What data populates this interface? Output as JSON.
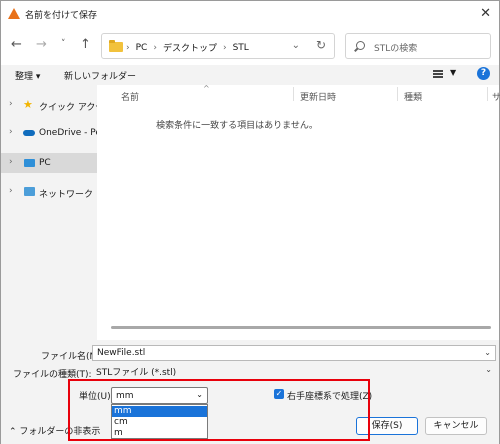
{
  "window": {
    "title": "名前を付けて保存"
  },
  "nav": {
    "back": "←",
    "forward": "→",
    "recent": "˅",
    "up": "↑",
    "breadcrumbs": [
      "PC",
      "デスクトップ",
      "STL"
    ],
    "sep": "›",
    "refresh": "↻",
    "search_placeholder": "STLの検索"
  },
  "toolbar": {
    "organize": "整理 ▾",
    "new_folder": "新しいフォルダー",
    "help": "?"
  },
  "sidebar": {
    "items": [
      {
        "label": "クイック アクセス"
      },
      {
        "label": "OneDrive - Per"
      },
      {
        "label": "PC"
      },
      {
        "label": "ネットワーク"
      }
    ]
  },
  "filelist": {
    "columns": [
      "名前",
      "更新日時",
      "種類",
      "サ"
    ],
    "empty_message": "検索条件に一致する項目はありません。"
  },
  "form": {
    "filename_label": "ファイル名(N):",
    "filename_value": "NewFile.stl",
    "filetype_label": "ファイルの種類(T):",
    "filetype_value": "STLファイル (*.stl)",
    "unit_label": "単位(U):",
    "unit_value": "mm",
    "unit_options": [
      "mm",
      "cm",
      "m"
    ],
    "checkbox_label": "右手座標系で処理(Z)",
    "hide_folders": "フォルダーの非表示",
    "save": "保存(S)",
    "cancel": "キャンセル"
  },
  "colors": {
    "accent": "#1a73d9",
    "highlight_box": "#e8000b"
  }
}
